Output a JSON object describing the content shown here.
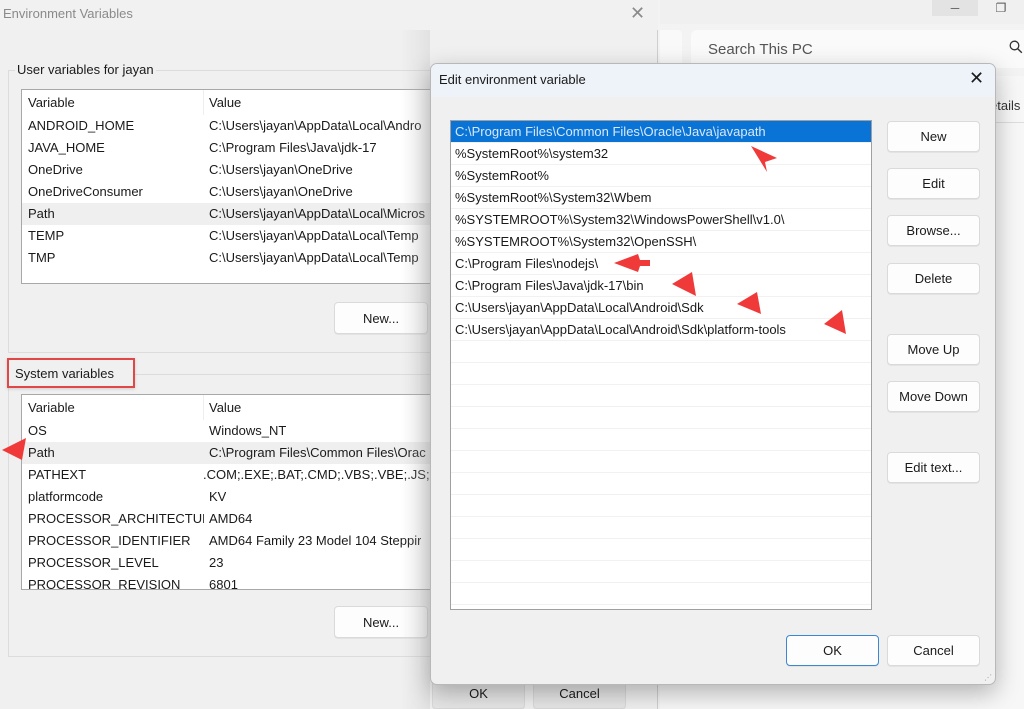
{
  "background_window": {
    "search_placeholder": "Search This PC",
    "search_icon": "search-icon",
    "details_label": "etails",
    "controls": {
      "minimize": "─",
      "restore": "❐"
    }
  },
  "env_dialog": {
    "title": "Environment Variables",
    "close_glyph": "✕",
    "user_group_label": "User variables for jayan",
    "system_group_label": "System variables",
    "columns": {
      "variable": "Variable",
      "value": "Value"
    },
    "user_variables": [
      {
        "variable": "ANDROID_HOME",
        "value": "C:\\Users\\jayan\\AppData\\Local\\Andro"
      },
      {
        "variable": "JAVA_HOME",
        "value": "C:\\Program Files\\Java\\jdk-17"
      },
      {
        "variable": "OneDrive",
        "value": "C:\\Users\\jayan\\OneDrive"
      },
      {
        "variable": "OneDriveConsumer",
        "value": "C:\\Users\\jayan\\OneDrive"
      },
      {
        "variable": "Path",
        "value": "C:\\Users\\jayan\\AppData\\Local\\Micros",
        "selected": true
      },
      {
        "variable": "TEMP",
        "value": "C:\\Users\\jayan\\AppData\\Local\\Temp"
      },
      {
        "variable": "TMP",
        "value": "C:\\Users\\jayan\\AppData\\Local\\Temp"
      }
    ],
    "system_variables": [
      {
        "variable": "OS",
        "value": "Windows_NT"
      },
      {
        "variable": "Path",
        "value": "C:\\Program Files\\Common Files\\Orac",
        "selected": true
      },
      {
        "variable": "PATHEXT",
        "value": ".COM;.EXE;.BAT;.CMD;.VBS;.VBE;.JS;.JS"
      },
      {
        "variable": "platformcode",
        "value": "KV"
      },
      {
        "variable": "PROCESSOR_ARCHITECTURE",
        "value": "AMD64"
      },
      {
        "variable": "PROCESSOR_IDENTIFIER",
        "value": "AMD64 Family 23 Model 104 Steppir"
      },
      {
        "variable": "PROCESSOR_LEVEL",
        "value": "23"
      },
      {
        "variable": "PROCESSOR_REVISION",
        "value": "6801"
      }
    ],
    "buttons": {
      "user_new": "New...",
      "system_new": "New...",
      "ok": "OK",
      "cancel": "Cancel"
    }
  },
  "edit_dialog": {
    "title": "Edit environment variable",
    "close_glyph": "✕",
    "path_entries": [
      {
        "text": "C:\\Program Files\\Common Files\\Oracle\\Java\\javapath",
        "selected": true
      },
      {
        "text": "%SystemRoot%\\system32"
      },
      {
        "text": "%SystemRoot%"
      },
      {
        "text": "%SystemRoot%\\System32\\Wbem"
      },
      {
        "text": "%SYSTEMROOT%\\System32\\WindowsPowerShell\\v1.0\\"
      },
      {
        "text": "%SYSTEMROOT%\\System32\\OpenSSH\\"
      },
      {
        "text": "C:\\Program Files\\nodejs\\"
      },
      {
        "text": "C:\\Program Files\\Java\\jdk-17\\bin"
      },
      {
        "text": "C:\\Users\\jayan\\AppData\\Local\\Android\\Sdk"
      },
      {
        "text": "C:\\Users\\jayan\\AppData\\Local\\Android\\Sdk\\platform-tools"
      }
    ],
    "buttons": {
      "new": "New",
      "edit": "Edit",
      "browse": "Browse...",
      "delete": "Delete",
      "move_up": "Move Up",
      "move_down": "Move Down",
      "edit_text": "Edit text...",
      "ok": "OK",
      "cancel": "Cancel"
    }
  },
  "annotations": {
    "arrow_color": "#f03a3a",
    "highlight_color": "#e04848"
  }
}
